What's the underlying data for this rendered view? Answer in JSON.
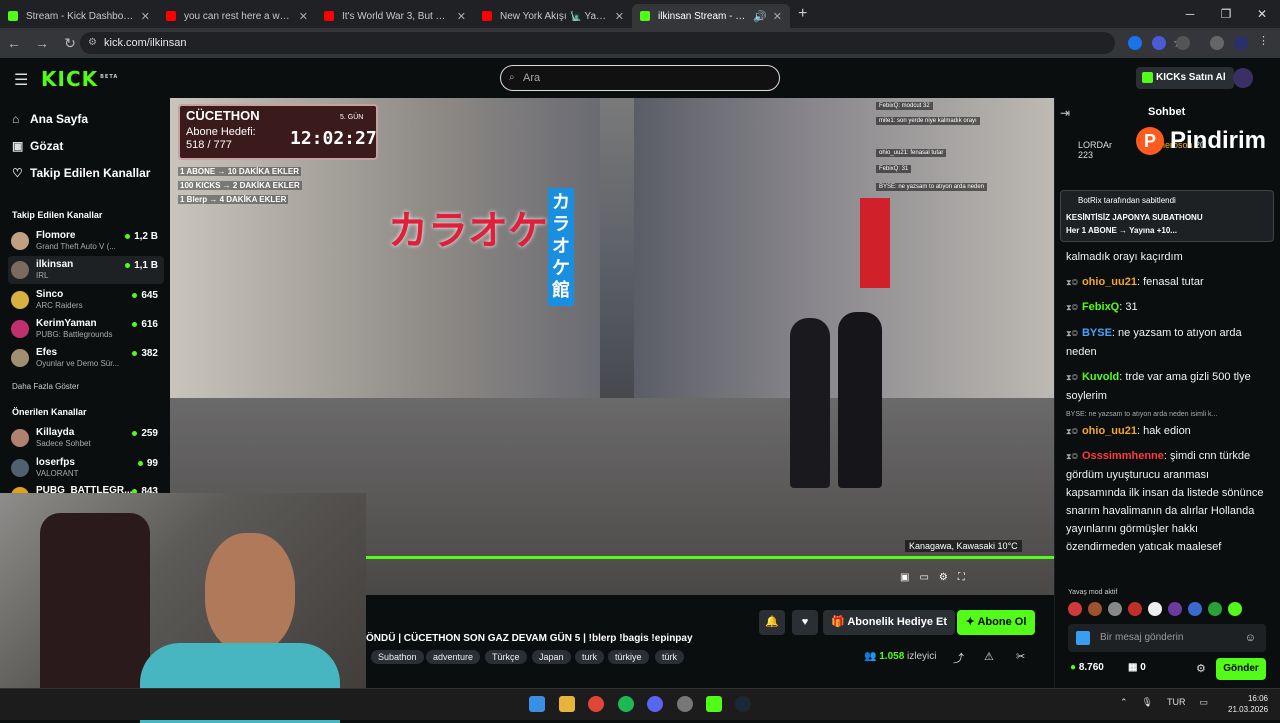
{
  "browser": {
    "tabs": [
      {
        "title": "Stream - Kick Dashboard",
        "favicon_color": "#53fc18"
      },
      {
        "title": "you can rest here a while. - You",
        "favicon_color": "#ff0000"
      },
      {
        "title": "It's World War 3, But You're Go",
        "favicon_color": "#ff0000"
      },
      {
        "title": "New York Akışı 🗽 Yaratıcı İş G",
        "favicon_color": "#ff0000"
      },
      {
        "title": "ilkinsan Stream - Watch Liv",
        "favicon_color": "#53fc18"
      }
    ],
    "url": "kick.com/ilkinsan",
    "new_tab": "+"
  },
  "header": {
    "logo": "KICK",
    "logo_badge": "BETA",
    "search_placeholder": "Ara",
    "kicks_button": "KICKs Satın Al"
  },
  "sidebar": {
    "nav": [
      {
        "label": "Ana Sayfa",
        "icon": "home-icon"
      },
      {
        "label": "Gözat",
        "icon": "browse-icon"
      },
      {
        "label": "Takip Edilen Kanallar",
        "icon": "heart-icon"
      }
    ],
    "followed_title": "Takip Edilen Kanallar",
    "followed": [
      {
        "name": "Flomore",
        "game": "Grand Theft Auto V (...",
        "viewers": "1,2 B",
        "color": "#c0a080"
      },
      {
        "name": "ilkinsan",
        "game": "IRL",
        "viewers": "1,1 B",
        "color": "#7a6a60"
      },
      {
        "name": "Sinco",
        "game": "ARC Raiders",
        "viewers": "645",
        "color": "#d8b040"
      },
      {
        "name": "KerimYaman",
        "game": "PUBG: Battlegrounds",
        "viewers": "616",
        "color": "#c03070"
      },
      {
        "name": "Efes",
        "game": "Oyunlar ve Demo Sür...",
        "viewers": "382",
        "color": "#a09070"
      }
    ],
    "show_more": "Daha Fazla Göster",
    "recommended_title": "Önerilen Kanallar",
    "recommended": [
      {
        "name": "Killayda",
        "game": "Sadece Sohbet",
        "viewers": "259",
        "color": "#b08070"
      },
      {
        "name": "loserfps",
        "game": "VALORANT",
        "viewers": "99",
        "color": "#506070"
      },
      {
        "name": "PUBG_BATTLEGR...",
        "game": "",
        "viewers": "843",
        "color": "#e0a020"
      }
    ]
  },
  "stream_overlay": {
    "event": "CÜCETHON",
    "day": "5. GÜN",
    "goal_label": "Abone Hedefi:",
    "goal_value": "518 / 777",
    "timer": "12:02:27",
    "rules": [
      "1 ABONE → 10 DAKİKA EKLER",
      "100 KICKS → 2 DAKİKA EKLER",
      "1 Blerp → 4 DAKİKA EKLER"
    ],
    "video_chat": [
      "FebixQ: modcut 32",
      "mite1: son yerde niye kalmadık orayı",
      "ohio_uu21: fenasal tutar",
      "FebixQ: 31",
      "BYSE: ne yazsam to atıyon arda neden"
    ],
    "location": "Kanagawa, Kawasaki 10°C",
    "sign_karaoke": "カラオケ館",
    "sign_karaoke2": "カラオケ"
  },
  "stream_info": {
    "title": "ÖNDÜ | CÜCETHON SON GAZ DEVAM GÜN 5 | !blerp !bagis !epinpay",
    "tags": [
      "Subathon",
      "adventure",
      "Türkçe",
      "Japan",
      "turk",
      "türkiye",
      "türk"
    ],
    "gift_button": "Abonelik Hediye Et",
    "subscribe_button": "Abone Ol",
    "viewers": "1.058",
    "viewers_label": "izleyici"
  },
  "chat": {
    "title": "Sohbet",
    "leaderboard": [
      {
        "name": "LORDAr",
        "value": "223"
      },
      {
        "name": "heroson",
        "value": "20"
      }
    ],
    "brand_popup": "Pindirim",
    "pinned_by": "BotRix tarafından sabitlendi",
    "pinned_line1": "KESİNTİSİZ JAPONYA SUBATHONU",
    "pinned_line2": "Her 1 ABONE → Yayına +10...",
    "messages": [
      {
        "user": "",
        "text": "kalmadık orayı kaçırdım",
        "color": "#ffffff"
      },
      {
        "user": "ohio_uu21",
        "text": "fenasal tutar",
        "color": "#f5a623"
      },
      {
        "user": "FebixQ",
        "text": "31",
        "color": "#53fc18"
      },
      {
        "user": "BYSE",
        "text": "ne yazsam to atıyon arda neden",
        "color": "#4aa3ff"
      },
      {
        "user": "Kuvold",
        "text": "trde var ama gizli 500 tlye soylerim",
        "color": "#53fc18"
      },
      {
        "user": "ohio_uu21",
        "text": "hak edion",
        "color": "#f5a623"
      },
      {
        "user": "Osssimmhenne",
        "text": "şimdi cnn türkde gördüm uyuşturucu aranması kapsamında ilk insan da listede sönünce snarım havalimanın da alırlar Hollanda yayınlarını görmüşler hakkı özendirmeden yatıcak maalesef",
        "color": "#ff3b3b"
      }
    ],
    "reply_preview": "BYSE: ne yazsam to atıyon arda neden isimli k...",
    "slow_mode": "Yavaş mod aktif",
    "input_placeholder": "Bir mesaj gönderin",
    "points": "8.760",
    "gifts": "0",
    "send_button": "Gönder"
  },
  "taskbar": {
    "lang": "TUR",
    "time": "16:06",
    "date": "21.03.2026"
  }
}
